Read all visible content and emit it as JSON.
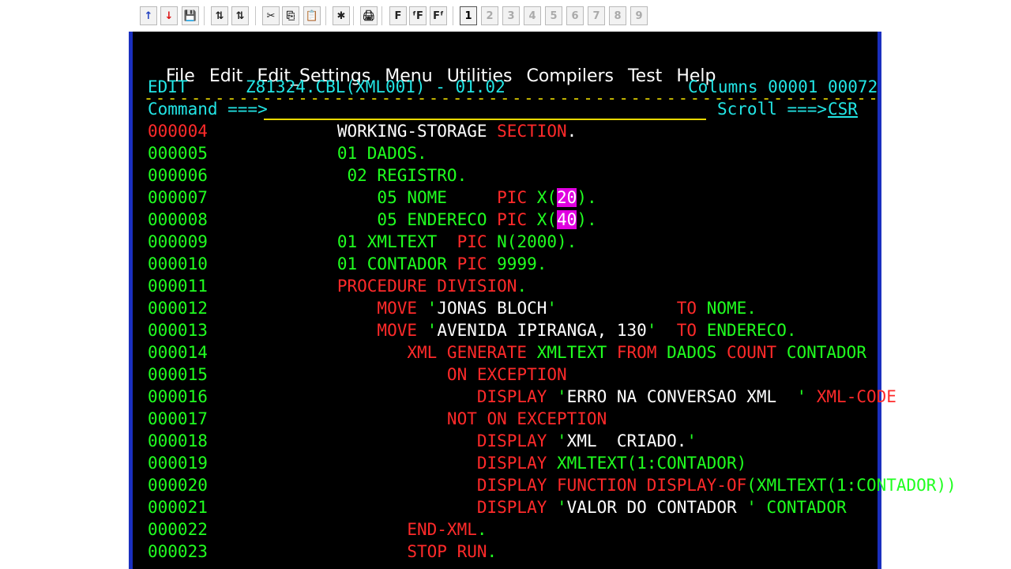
{
  "toolbar": {
    "buttons": [
      "↑",
      "↓",
      "💾",
      "⇅",
      "⇅",
      "✂",
      "⎘",
      "📋",
      "✱",
      "🖨",
      "F",
      "ᶠF",
      "Fᶠ"
    ],
    "sessions": [
      "1",
      "2",
      "3",
      "4",
      "5",
      "6",
      "7",
      "8",
      "9"
    ]
  },
  "menu": [
    "File",
    "Edit",
    "Edit_Settings",
    "Menu",
    "Utilities",
    "Compilers",
    "Test",
    "Help"
  ],
  "header": {
    "mode": "EDIT",
    "dataset": "Z81324.CBL(XML001) - 01.02",
    "columns": "Columns 00001 00072",
    "command_label": "Command ===>",
    "command_value": "",
    "scroll_label": "Scroll ===>",
    "scroll_value": "CSR"
  },
  "lines": [
    {
      "n": "000004",
      "seg": [
        {
          "t": "      WORKING-STORAGE ",
          "c": "w"
        },
        {
          "t": "SECTION",
          "c": "r"
        },
        {
          "t": ".",
          "c": "w"
        }
      ]
    },
    {
      "n": "000005",
      "seg": [
        {
          "t": "      01 DADOS.",
          "c": "g"
        }
      ]
    },
    {
      "n": "000006",
      "seg": [
        {
          "t": "       02 REGISTRO.",
          "c": "g"
        }
      ]
    },
    {
      "n": "000007",
      "seg": [
        {
          "t": "          05 NOME     ",
          "c": "g"
        },
        {
          "t": "PIC ",
          "c": "r"
        },
        {
          "t": "X(",
          "c": "g"
        },
        {
          "t": "20",
          "c": "m"
        },
        {
          "t": ").",
          "c": "g"
        }
      ]
    },
    {
      "n": "000008",
      "seg": [
        {
          "t": "          05 ENDERECO ",
          "c": "g"
        },
        {
          "t": "PIC ",
          "c": "r"
        },
        {
          "t": "X(",
          "c": "g"
        },
        {
          "t": "40",
          "c": "m"
        },
        {
          "t": ").",
          "c": "g"
        }
      ]
    },
    {
      "n": "000009",
      "seg": [
        {
          "t": "      01 XMLTEXT  ",
          "c": "g"
        },
        {
          "t": "PIC ",
          "c": "r"
        },
        {
          "t": "N(2000).",
          "c": "g"
        }
      ]
    },
    {
      "n": "000010",
      "seg": [
        {
          "t": "      01 CONTADOR ",
          "c": "g"
        },
        {
          "t": "PIC ",
          "c": "r"
        },
        {
          "t": "9999.",
          "c": "g"
        }
      ]
    },
    {
      "n": "000011",
      "seg": [
        {
          "t": "      PROCEDURE DIVISION",
          "c": "r"
        },
        {
          "t": ".",
          "c": "g"
        }
      ]
    },
    {
      "n": "000012",
      "seg": [
        {
          "t": "          MOVE ",
          "c": "r"
        },
        {
          "t": "'",
          "c": "g"
        },
        {
          "t": "JONAS BLOCH",
          "c": "w"
        },
        {
          "t": "'            ",
          "c": "g"
        },
        {
          "t": "TO ",
          "c": "r"
        },
        {
          "t": "NOME.",
          "c": "g"
        }
      ]
    },
    {
      "n": "000013",
      "seg": [
        {
          "t": "          MOVE ",
          "c": "r"
        },
        {
          "t": "'",
          "c": "g"
        },
        {
          "t": "AVENIDA IPIRANGA, 130",
          "c": "w"
        },
        {
          "t": "'  ",
          "c": "g"
        },
        {
          "t": "TO ",
          "c": "r"
        },
        {
          "t": "ENDERECO.",
          "c": "g"
        }
      ]
    },
    {
      "n": "000014",
      "seg": [
        {
          "t": "             XML GENERATE ",
          "c": "r"
        },
        {
          "t": "XMLTEXT ",
          "c": "g"
        },
        {
          "t": "FROM ",
          "c": "r"
        },
        {
          "t": "DADOS ",
          "c": "g"
        },
        {
          "t": "COUNT ",
          "c": "r"
        },
        {
          "t": "CONTADOR",
          "c": "g"
        }
      ]
    },
    {
      "n": "000015",
      "seg": [
        {
          "t": "                 ON EXCEPTION",
          "c": "r"
        }
      ]
    },
    {
      "n": "000016",
      "seg": [
        {
          "t": "                    DISPLAY ",
          "c": "r"
        },
        {
          "t": "'",
          "c": "g"
        },
        {
          "t": "ERRO NA CONVERSAO XML  ",
          "c": "w"
        },
        {
          "t": "' ",
          "c": "g"
        },
        {
          "t": "XML-CODE",
          "c": "r"
        }
      ]
    },
    {
      "n": "000017",
      "seg": [
        {
          "t": "                 NOT ON EXCEPTION",
          "c": "r"
        }
      ]
    },
    {
      "n": "000018",
      "seg": [
        {
          "t": "                    DISPLAY ",
          "c": "r"
        },
        {
          "t": "'",
          "c": "g"
        },
        {
          "t": "XML  CRIADO.",
          "c": "w"
        },
        {
          "t": "'",
          "c": "g"
        }
      ]
    },
    {
      "n": "000019",
      "seg": [
        {
          "t": "                    DISPLAY ",
          "c": "r"
        },
        {
          "t": "XMLTEXT(1:CONTADOR)",
          "c": "g"
        }
      ]
    },
    {
      "n": "000020",
      "seg": [
        {
          "t": "                    DISPLAY FUNCTION DISPLAY-OF",
          "c": "r"
        },
        {
          "t": "(XMLTEXT(1:CONTADOR))",
          "c": "g"
        }
      ]
    },
    {
      "n": "000021",
      "seg": [
        {
          "t": "                    DISPLAY ",
          "c": "r"
        },
        {
          "t": "'",
          "c": "g"
        },
        {
          "t": "VALOR DO CONTADOR ",
          "c": "w"
        },
        {
          "t": "' ",
          "c": "g"
        },
        {
          "t": "CONTADOR",
          "c": "g"
        }
      ]
    },
    {
      "n": "000022",
      "seg": [
        {
          "t": "             END-XML",
          "c": "r"
        },
        {
          "t": ".",
          "c": "g"
        }
      ]
    },
    {
      "n": "000023",
      "seg": [
        {
          "t": "             STOP RUN",
          "c": "r"
        },
        {
          "t": ".",
          "c": "g"
        }
      ]
    }
  ]
}
